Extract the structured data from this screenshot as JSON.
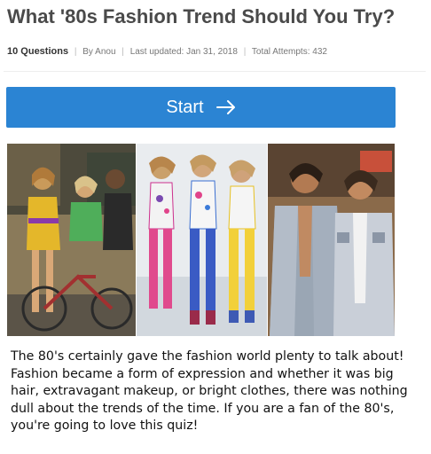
{
  "quiz": {
    "title": "What '80s Fashion Trend Should You Try?",
    "question_count": "10 Questions",
    "author": "By Anou",
    "last_updated": "Last updated: Jan 31, 2018",
    "total_attempts": "Total Attempts: 432"
  },
  "start_button": {
    "label": "Start",
    "icon": "arrow-right-icon",
    "color": "#2b84d3"
  },
  "hero_image": {
    "panels": [
      "street-style-photo",
      "leotard-fashion-photo",
      "denim-jackets-photo"
    ]
  },
  "description": "The 80's certainly gave the fashion world plenty to talk about! Fashion became a form of expression and whether it was big hair, extravagant makeup, or bright clothes, there was nothing dull about the trends of the time. If you are a fan of the 80's, you're going to love this quiz!"
}
